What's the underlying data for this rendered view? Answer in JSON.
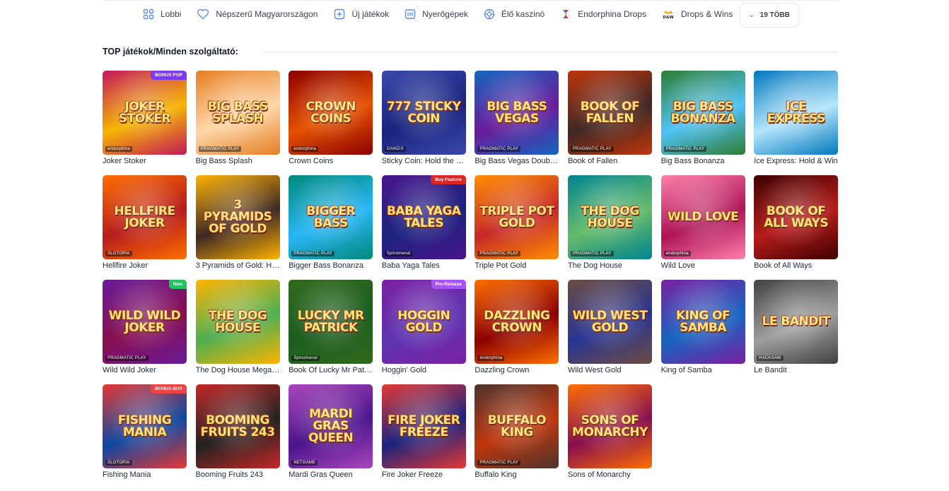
{
  "nav": {
    "items": [
      {
        "label": "Lobbi",
        "icon": "grid-icon"
      },
      {
        "label": "Népszerű Magyarországon",
        "icon": "heart-icon"
      },
      {
        "label": "Új játékok",
        "icon": "plus-square-icon"
      },
      {
        "label": "Nyerőgépek",
        "icon": "slot-machine-icon"
      },
      {
        "label": "Élő kaszinó",
        "icon": "roulette-icon"
      },
      {
        "label": "Endorphina Drops",
        "icon": "endorphina-logo-icon"
      },
      {
        "label": "Drops & Wins",
        "icon": "drops-wins-icon"
      }
    ],
    "more_label": "19 TÖBB"
  },
  "section": {
    "title": "TOP játékok/Minden szolgáltató:"
  },
  "games": [
    {
      "name": "Joker Stoker",
      "art": "JOKER STOKER",
      "provider": "endorphina",
      "badge": "BONUS POP",
      "colors": [
        "#f7b500",
        "#c2185b"
      ]
    },
    {
      "name": "Big Bass Splash",
      "art": "BIG BASS SPLASH",
      "provider": "PRAGMATIC PLAY",
      "badge": "",
      "colors": [
        "#ffd7a8",
        "#e67e22"
      ]
    },
    {
      "name": "Crown Coins",
      "art": "CROWN COINS",
      "provider": "endorphina",
      "badge": "",
      "colors": [
        "#e65100",
        "#8b0000"
      ]
    },
    {
      "name": "Sticky Coin: Hold the Spin",
      "art": "777 STICKY COIN",
      "provider": "GAMZIX",
      "badge": "",
      "colors": [
        "#1a237e",
        "#3949ab"
      ]
    },
    {
      "name": "Big Bass Vegas Double Down Deluxe",
      "art": "BIG BASS VEGAS",
      "provider": "PRAGMATIC PLAY",
      "badge": "",
      "colors": [
        "#6a1b9a",
        "#1565c0"
      ]
    },
    {
      "name": "Book of Fallen",
      "art": "BOOK OF FALLEN",
      "provider": "PRAGMATIC PLAY",
      "badge": "",
      "colors": [
        "#3e2723",
        "#bf360c"
      ]
    },
    {
      "name": "Big Bass Bonanza",
      "art": "BIG BASS BONANZA",
      "provider": "PRAGMATIC PLAY",
      "badge": "",
      "colors": [
        "#4fc3f7",
        "#2e7d32"
      ]
    },
    {
      "name": "Ice Express: Hold & Win",
      "art": "ICE EXPRESS",
      "provider": "",
      "badge": "",
      "colors": [
        "#b3e5fc",
        "#0277bd"
      ]
    },
    {
      "name": "Hellfire Joker",
      "art": "HELLFIRE JOKER",
      "provider": "SLOTOPIA",
      "badge": "",
      "colors": [
        "#b71c1c",
        "#ff6f00"
      ]
    },
    {
      "name": "3 Pyramids of Gold: Hold & Coin",
      "art": "3 PYRAMIDS OF GOLD",
      "provider": "",
      "badge": "",
      "colors": [
        "#3e2723",
        "#ffb300"
      ]
    },
    {
      "name": "Bigger Bass Bonanza",
      "art": "BIGGER BASS",
      "provider": "PRAGMATIC PLAY",
      "badge": "",
      "colors": [
        "#29b6f6",
        "#00897b"
      ]
    },
    {
      "name": "Baba Yaga Tales",
      "art": "BABA YAGA TALES",
      "provider": "Spinomenal",
      "badge": "Buy Feature",
      "colors": [
        "#1a237e",
        "#4a148c"
      ]
    },
    {
      "name": "Triple Pot Gold",
      "art": "TRIPLE POT GOLD",
      "provider": "PRAGMATIC PLAY",
      "badge": "",
      "colors": [
        "#c62828",
        "#ff8f00"
      ]
    },
    {
      "name": "The Dog House",
      "art": "THE DOG HOUSE",
      "provider": "PRAGMATIC PLAY",
      "badge": "",
      "colors": [
        "#66bb6a",
        "#00838f"
      ]
    },
    {
      "name": "Wild Love",
      "art": "WILD LOVE",
      "provider": "endorphina",
      "badge": "",
      "colors": [
        "#ad1457",
        "#ff80ab"
      ]
    },
    {
      "name": "Book of All Ways",
      "art": "BOOK OF ALL WAYS",
      "provider": "",
      "badge": "",
      "colors": [
        "#b71c1c",
        "#3e0000"
      ]
    },
    {
      "name": "Wild Wild Joker",
      "art": "WILD WILD JOKER",
      "provider": "PRAGMATIC PLAY",
      "badge": "New",
      "colors": [
        "#880e4f",
        "#6a1b9a"
      ]
    },
    {
      "name": "The Dog House Megaways",
      "art": "THE DOG HOUSE",
      "provider": "",
      "badge": "",
      "colors": [
        "#4caf50",
        "#ffb300"
      ]
    },
    {
      "name": "Book Of Lucky Mr Patrick",
      "art": "LUCKY MR PATRICK",
      "provider": "Spinomenal",
      "badge": "",
      "colors": [
        "#1b5e20",
        "#33691e"
      ]
    },
    {
      "name": "Hoggin' Gold",
      "art": "HOGGIN GOLD",
      "provider": "",
      "badge": "Pre-Release",
      "colors": [
        "#5e35b1",
        "#7b1fa2"
      ]
    },
    {
      "name": "Dazzling Crown",
      "art": "DAZZLING CROWN",
      "provider": "endorphina",
      "badge": "",
      "colors": [
        "#8b0000",
        "#ff6f00"
      ]
    },
    {
      "name": "Wild West Gold",
      "art": "WILD WEST GOLD",
      "provider": "",
      "badge": "",
      "colors": [
        "#283593",
        "#6d4c41"
      ]
    },
    {
      "name": "King of Samba",
      "art": "KING OF SAMBA",
      "provider": "",
      "badge": "",
      "colors": [
        "#1565c0",
        "#7b1fa2"
      ]
    },
    {
      "name": "Le Bandit",
      "art": "LE BANDIT",
      "provider": "HACKSAW",
      "badge": "",
      "colors": [
        "#9e9e9e",
        "#424242"
      ]
    },
    {
      "name": "Fishing Mania",
      "art": "FISHING MANIA",
      "provider": "SLOTOPIA",
      "badge": "BONUS BUY",
      "colors": [
        "#0d47a1",
        "#e53935"
      ]
    },
    {
      "name": "Booming Fruits 243",
      "art": "BOOMING FRUITS 243",
      "provider": "",
      "badge": "",
      "colors": [
        "#212121",
        "#c62828"
      ]
    },
    {
      "name": "Mardi Gras Queen",
      "art": "MARDI GRAS QUEEN",
      "provider": "NETGAME",
      "badge": "",
      "colors": [
        "#4a148c",
        "#ab47bc"
      ]
    },
    {
      "name": "Fire Joker Freeze",
      "art": "FIRE JOKER FREEZE",
      "provider": "",
      "badge": "",
      "colors": [
        "#1a237e",
        "#e53935"
      ]
    },
    {
      "name": "Buffalo King",
      "art": "BUFFALO KING",
      "provider": "PRAGMATIC PLAY",
      "badge": "",
      "colors": [
        "#bf360c",
        "#4e342e"
      ]
    },
    {
      "name": "Sons of Monarchy",
      "art": "SONS OF MONARCHY",
      "provider": "",
      "badge": "",
      "colors": [
        "#880e4f",
        "#ff6f00"
      ]
    }
  ]
}
